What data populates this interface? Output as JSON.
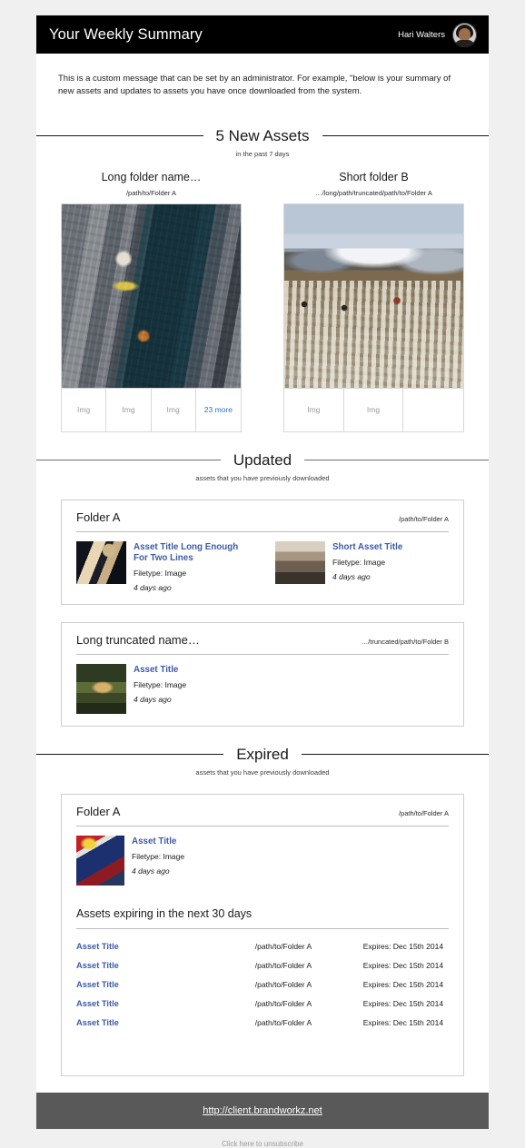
{
  "header": {
    "title": "Your Weekly Summary",
    "user_name": "Hari Walters",
    "avatar_icon": "user-avatar-photo"
  },
  "intro": {
    "message": "This is a custom message that can be set by an administrator. For example, \"below is your summary of new assets and updates to assets you have once downloaded from the system."
  },
  "sections": {
    "new_assets": {
      "heading": "5 New Assets",
      "subheading": "in the past 7 days",
      "folders": [
        {
          "name": "Long folder name…",
          "path": "/path/to/Folder A",
          "hero_image": "aerial-waterfront-city-photo",
          "thumbs": [
            "Img",
            "Img",
            "Img"
          ],
          "more_label": "23 more"
        },
        {
          "name": "Short folder B",
          "path": "…/long/path/truncated/path/to/Folder A",
          "hero_image": "snow-mountain-sheep-herd-photo",
          "thumbs": [
            "Img",
            "Img"
          ],
          "more_label": ""
        }
      ]
    },
    "updated": {
      "heading": "Updated",
      "subheading": "assets that you have previously downloaded",
      "cards": [
        {
          "folder_title": "Folder A",
          "folder_path": "/path/to/Folder A",
          "assets": [
            {
              "title": "Asset Title Long Enough For Two Lines",
              "filetype": "Filetype: Image",
              "ago": "4 days ago",
              "thumb_icon": "fitness-dumbbell-photo"
            },
            {
              "title": "Short Asset Title",
              "filetype": "Filetype: Image",
              "ago": "4 days ago",
              "thumb_icon": "gym-interior-photo"
            }
          ]
        },
        {
          "folder_title": "Long truncated name…",
          "folder_path": "…/truncated/path/to/Folder B",
          "assets": [
            {
              "title": "Asset Title",
              "filetype": "Filetype: Image",
              "ago": "4 days ago",
              "thumb_icon": "house-landscape-photo"
            }
          ]
        }
      ]
    },
    "expired": {
      "heading": "Expired",
      "subheading": "assets that you have previously downloaded",
      "card": {
        "folder_title": "Folder A",
        "folder_path": "/path/to/Folder A",
        "assets": [
          {
            "title": "Asset Title",
            "filetype": "Filetype: Image",
            "ago": "4 days ago",
            "thumb_icon": "race-car-photo"
          }
        ],
        "expiring_heading": "Assets expiring in the next 30 days",
        "expiring_rows": [
          {
            "title": "Asset Title",
            "path": "/path/to/Folder A",
            "expires": "Expires: Dec 15th 2014"
          },
          {
            "title": "Asset Title",
            "path": "/path/to/Folder A",
            "expires": "Expires: Dec 15th 2014"
          },
          {
            "title": "Asset Title",
            "path": "/path/to/Folder A",
            "expires": "Expires: Dec 15th 2014"
          },
          {
            "title": "Asset Title",
            "path": "/path/to/Folder A",
            "expires": "Expires: Dec 15th 2014"
          },
          {
            "title": "Asset Title",
            "path": "/path/to/Folder A",
            "expires": "Expires: Dec 15th 2014"
          }
        ]
      }
    }
  },
  "footer": {
    "site_url": "http://client.brandworkz.net",
    "unsubscribe": "Click here to unsubscribe"
  },
  "colors": {
    "masthead_bg": "#000000",
    "footer_bg": "#595959",
    "link_blue": "#3b5ba5",
    "more_link_blue": "#2c6fcf",
    "page_bg": "#f0f0f0"
  }
}
